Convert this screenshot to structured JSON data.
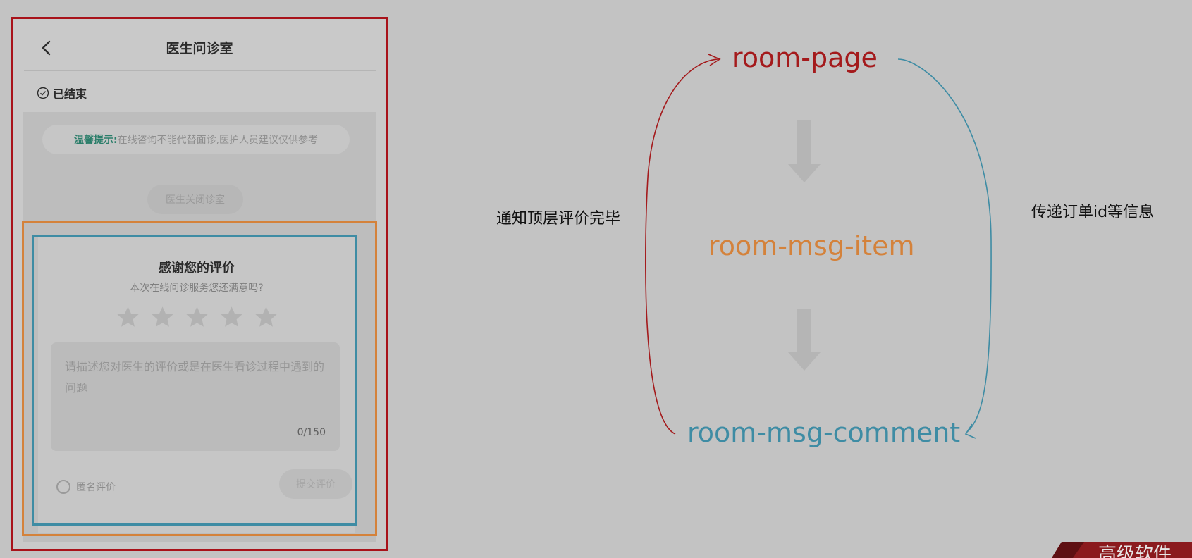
{
  "phone": {
    "nav_title": "医生问诊室",
    "status": "已结束",
    "tip_label": "温馨提示:",
    "tip_text": "在线咨询不能代替面诊,医护人员建议仅供参考",
    "closed_notice": "医生关闭诊室",
    "comment_card": {
      "title": "感谢您的评价",
      "subtitle": "本次在线问诊服务您还满意吗?",
      "stars_total": 5,
      "stars_selected": 0,
      "placeholder": "请描述您对医生的评价或是在医生看诊过程中遇到的问题",
      "counter": "0/150",
      "anonymous_label": "匿名评价",
      "submit_label": "提交评价"
    }
  },
  "diagram": {
    "nodes": {
      "top": "room-page",
      "middle": "room-msg-item",
      "bottom": "room-msg-comment"
    },
    "left_label": "通知顶层评价完毕",
    "right_label": "传递订单id等信息"
  },
  "colors": {
    "page_node": "#a41a1c",
    "item_node": "#d4823b",
    "comment_node": "#3e8ca4",
    "background": "#c3c3c3"
  },
  "icons": [
    "back-arrow-icon",
    "check-circle-icon",
    "star-icon",
    "down-arrow-icon"
  ],
  "badge": {
    "text": "高级软件"
  }
}
